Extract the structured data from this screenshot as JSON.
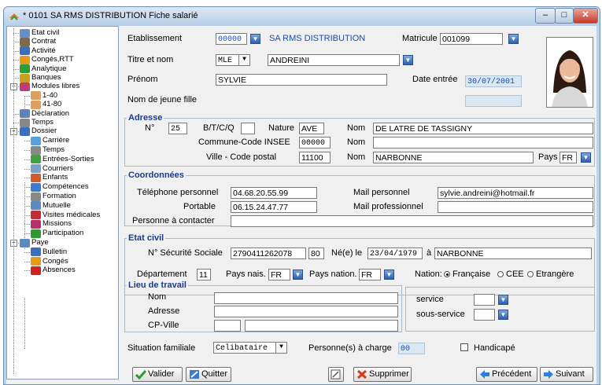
{
  "window": {
    "title": "* 0101  SA RMS DISTRIBUTION   Fiche salarié",
    "minimize": "–",
    "maximize": "□",
    "close": "✕"
  },
  "tree": {
    "items": [
      {
        "label": "Etat civil",
        "icon": "id-card-icon"
      },
      {
        "label": "Contrat",
        "icon": "contract-icon"
      },
      {
        "label": "Activité",
        "icon": "activity-icon"
      },
      {
        "label": "Congés,RTT",
        "icon": "vacation-icon"
      },
      {
        "label": "Analytique",
        "icon": "analytics-icon"
      },
      {
        "label": "Banques",
        "icon": "bank-icon"
      },
      {
        "label": "Modules libres",
        "icon": "modules-icon"
      },
      {
        "label": "1-40",
        "icon": "calendar-icon"
      },
      {
        "label": "41-80",
        "icon": "calendar-icon"
      },
      {
        "label": "Déclaration",
        "icon": "declaration-icon"
      },
      {
        "label": "Temps",
        "icon": "clock-icon"
      },
      {
        "label": "Dossier",
        "icon": "folder-icon"
      },
      {
        "label": "Carrière",
        "icon": "career-icon"
      },
      {
        "label": "Temps",
        "icon": "clock-icon"
      },
      {
        "label": "Entrées-Sorties",
        "icon": "arrows-icon"
      },
      {
        "label": "Courriers",
        "icon": "mail-icon"
      },
      {
        "label": "Enfants",
        "icon": "children-icon"
      },
      {
        "label": "Compétences",
        "icon": "skills-icon"
      },
      {
        "label": "Formation",
        "icon": "training-icon"
      },
      {
        "label": "Mutuelle",
        "icon": "insurance-icon"
      },
      {
        "label": "Visites médicales",
        "icon": "medical-icon"
      },
      {
        "label": "Missions",
        "icon": "mission-icon"
      },
      {
        "label": "Participation",
        "icon": "chart-icon"
      },
      {
        "label": "Paye",
        "icon": "pay-icon"
      },
      {
        "label": "Bulletin",
        "icon": "payslip-icon"
      },
      {
        "label": "Congés",
        "icon": "vacation-icon"
      },
      {
        "label": "Absences",
        "icon": "absence-icon"
      }
    ]
  },
  "header": {
    "etablissement_label": "Etablissement",
    "etablissement_code": "00000",
    "etablissement_name": "SA RMS DISTRIBUTION",
    "matricule_label": "Matricule",
    "matricule": "001099",
    "titre_label": "Titre et nom",
    "titre": "MLE",
    "nom": "ANDREINI",
    "prenom_label": "Prénom",
    "prenom": "SYLVIE",
    "date_entree_label": "Date entrée",
    "date_entree": "30/07/2001",
    "nom_jeune_fille_label": "Nom de jeune fille",
    "nom_jeune_fille": ""
  },
  "adresse": {
    "title": "Adresse",
    "numero_label": "N°",
    "numero": "25",
    "btcq_label": "B/T/C/Q",
    "btcq": "",
    "nature_label": "Nature",
    "nature": "AVE",
    "nom_label": "Nom",
    "nom": "DE LATRE DE TASSIGNY",
    "commune_label": "Commune-Code INSEE",
    "commune": "00000",
    "nom2_label": "Nom",
    "nom2": "",
    "ville_label": "Ville  - Code postal",
    "code_postal": "11100",
    "nom3_label": "Nom",
    "ville": "NARBONNE",
    "pays_label": "Pays",
    "pays": "FR"
  },
  "coordonnees": {
    "title": "Coordonnées",
    "tel_label": "Téléphone personnel",
    "tel": "04.68.20.55.99",
    "mail_perso_label": "Mail personnel",
    "mail_perso": "sylvie.andreini@hotmail.fr",
    "portable_label": "Portable",
    "portable": "06.15.24.47.77",
    "mail_pro_label": "Mail professionnel",
    "mail_pro": "",
    "contact_label": "Personne à contacter",
    "contact": ""
  },
  "etat_civil": {
    "title": "Etat civil",
    "secu_label": "N° Sécurité Sociale",
    "secu": "2790411262078",
    "secu_cle": "80",
    "ne_label": "Né(e) le",
    "date_naissance": "23/04/1979",
    "a_label": "à",
    "lieu_naissance": "NARBONNE",
    "departement_label": "Département",
    "departement": "11",
    "pays_nais_label": "Pays nais.",
    "pays_nais": "FR",
    "pays_nation_label": "Pays nation.",
    "pays_nation": "FR",
    "nation_label": "Nation:",
    "nation_options": [
      "Française",
      "CEE",
      "Etrangère"
    ]
  },
  "lieu_travail": {
    "title": "Lieu de travail",
    "nom_label": "Nom",
    "adresse_label": "Adresse",
    "cp_ville_label": "CP-Ville",
    "service_label": "service",
    "sous_service_label": "sous-service"
  },
  "situation": {
    "label": "Situation familiale",
    "value": "Celibataire",
    "charge_label": "Personne(s) à charge",
    "charge": "00",
    "handicape_label": "Handicapé"
  },
  "buttons": {
    "valider": "Valider",
    "quitter": "Quitter",
    "supprimer": "Supprimer",
    "precedent": "Précédent",
    "suivant": "Suivant"
  },
  "colors": {
    "section_title": "#1a3a8a",
    "link_blue": "#1a4ab0",
    "readonly_bg": "#d8e7f2"
  }
}
